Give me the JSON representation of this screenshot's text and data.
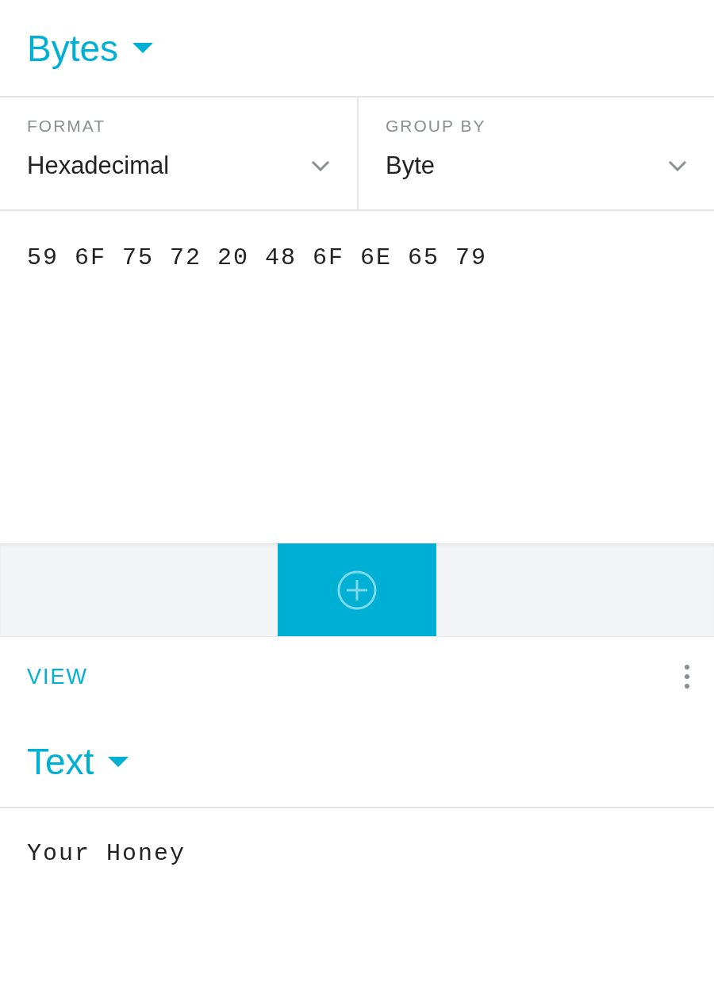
{
  "input_header": {
    "title": "Bytes"
  },
  "options": [
    {
      "label": "FORMAT",
      "value": "Hexadecimal"
    },
    {
      "label": "GROUP BY",
      "value": "Byte"
    }
  ],
  "input_text": "59 6F 75 72 20 48 6F 6E 65 79",
  "output": {
    "label": "VIEW",
    "title": "Text",
    "text": "Your Honey"
  }
}
